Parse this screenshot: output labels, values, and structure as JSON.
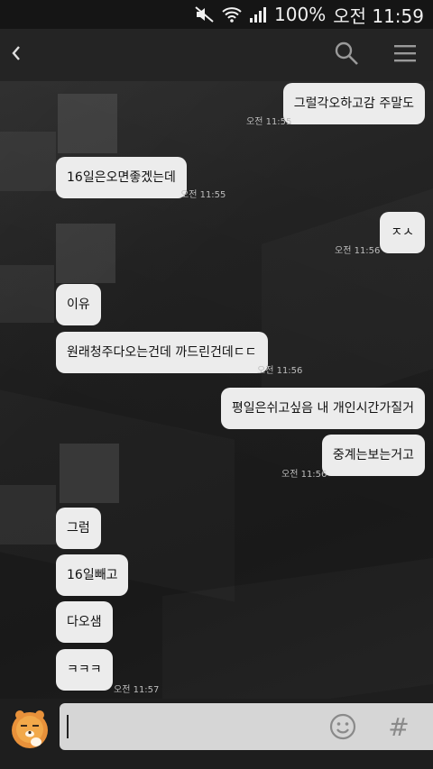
{
  "status_bar": {
    "battery": "100%",
    "time": "오전 11:59",
    "icons": [
      "mute-icon",
      "wifi-icon",
      "signal-icon"
    ]
  },
  "top_bar": {
    "icons": [
      "back-icon",
      "search-icon",
      "menu-icon"
    ]
  },
  "messages": [
    {
      "side": "right",
      "text": "그럴각오하고감 주말도",
      "time": "오전 11:55"
    },
    {
      "side": "left",
      "text": "16일은오면좋겠는데",
      "time": "오전 11:55"
    },
    {
      "side": "right",
      "text": "ㅈㅅ",
      "time": "오전 11:56"
    },
    {
      "side": "left",
      "text": "이유",
      "time": ""
    },
    {
      "side": "left",
      "text": "원래청주다오는건데 까드린건데ㄷㄷ",
      "time": "오전 11:56"
    },
    {
      "side": "right",
      "text": "평일은쉬고싶음 내 개인시간가질거",
      "time": ""
    },
    {
      "side": "right",
      "text": "중계는보는거고",
      "time": "오전 11:56"
    },
    {
      "side": "left",
      "text": "그럼",
      "time": ""
    },
    {
      "side": "left",
      "text": "16일빼고",
      "time": ""
    },
    {
      "side": "left",
      "text": "다오샘",
      "time": ""
    },
    {
      "side": "left",
      "text": "ㅋㅋㅋ",
      "time": "오전 11:57"
    }
  ],
  "input": {
    "value": "",
    "icons": [
      "emoji-icon",
      "hash-icon"
    ],
    "hash_symbol": "#"
  },
  "colors": {
    "bubble": "#ececec",
    "top_bar": "#242424",
    "status_bar": "#151515",
    "input_bg": "#d6d6d6"
  }
}
